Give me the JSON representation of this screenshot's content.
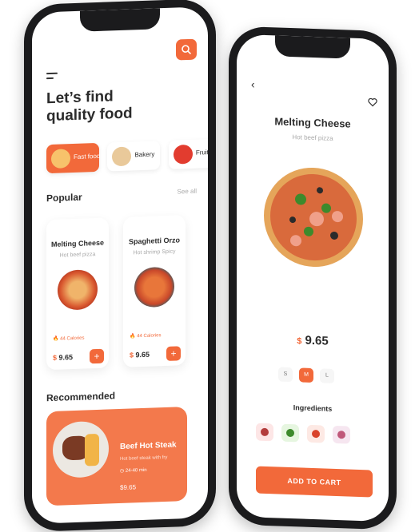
{
  "home": {
    "headline_line1": "Let’s find",
    "headline_line2": "quality food",
    "categories": [
      {
        "label": "Fast food",
        "icon": "burger-icon"
      },
      {
        "label": "Bakery",
        "icon": "sandwich-icon"
      },
      {
        "label": "Fruit it",
        "icon": "strawberry-icon"
      }
    ],
    "popular_title": "Popular",
    "see_all": "See all",
    "popular": [
      {
        "title": "Melting Cheese",
        "subtitle": "Hot beef pizza",
        "calories": "44 Calories",
        "price": "9.65",
        "currency": "$"
      },
      {
        "title": "Spaghetti Orzo",
        "subtitle": "Hot shrimp Spicy",
        "calories": "44 Calories",
        "price": "9.65",
        "currency": "$"
      }
    ],
    "recommended_title": "Recommended",
    "recommended": {
      "title": "Beef Hot Steak",
      "subtitle": "Hot beef steak with fry",
      "time": "24-40 min",
      "price": "$9.65"
    }
  },
  "detail": {
    "title": "Melting Cheese",
    "subtitle": "Hot beef pizza",
    "currency": "$",
    "price": "9.65",
    "sizes": [
      "S",
      "M",
      "L"
    ],
    "selected_size": "M",
    "ingredients_title": "Ingredients",
    "ingredients": [
      "meat",
      "basil",
      "tomato",
      "onion"
    ],
    "cart_button": "ADD TO CART"
  },
  "colors": {
    "accent": "#f2693a",
    "background": "#ffffff",
    "frame": "#1b1b1d"
  }
}
